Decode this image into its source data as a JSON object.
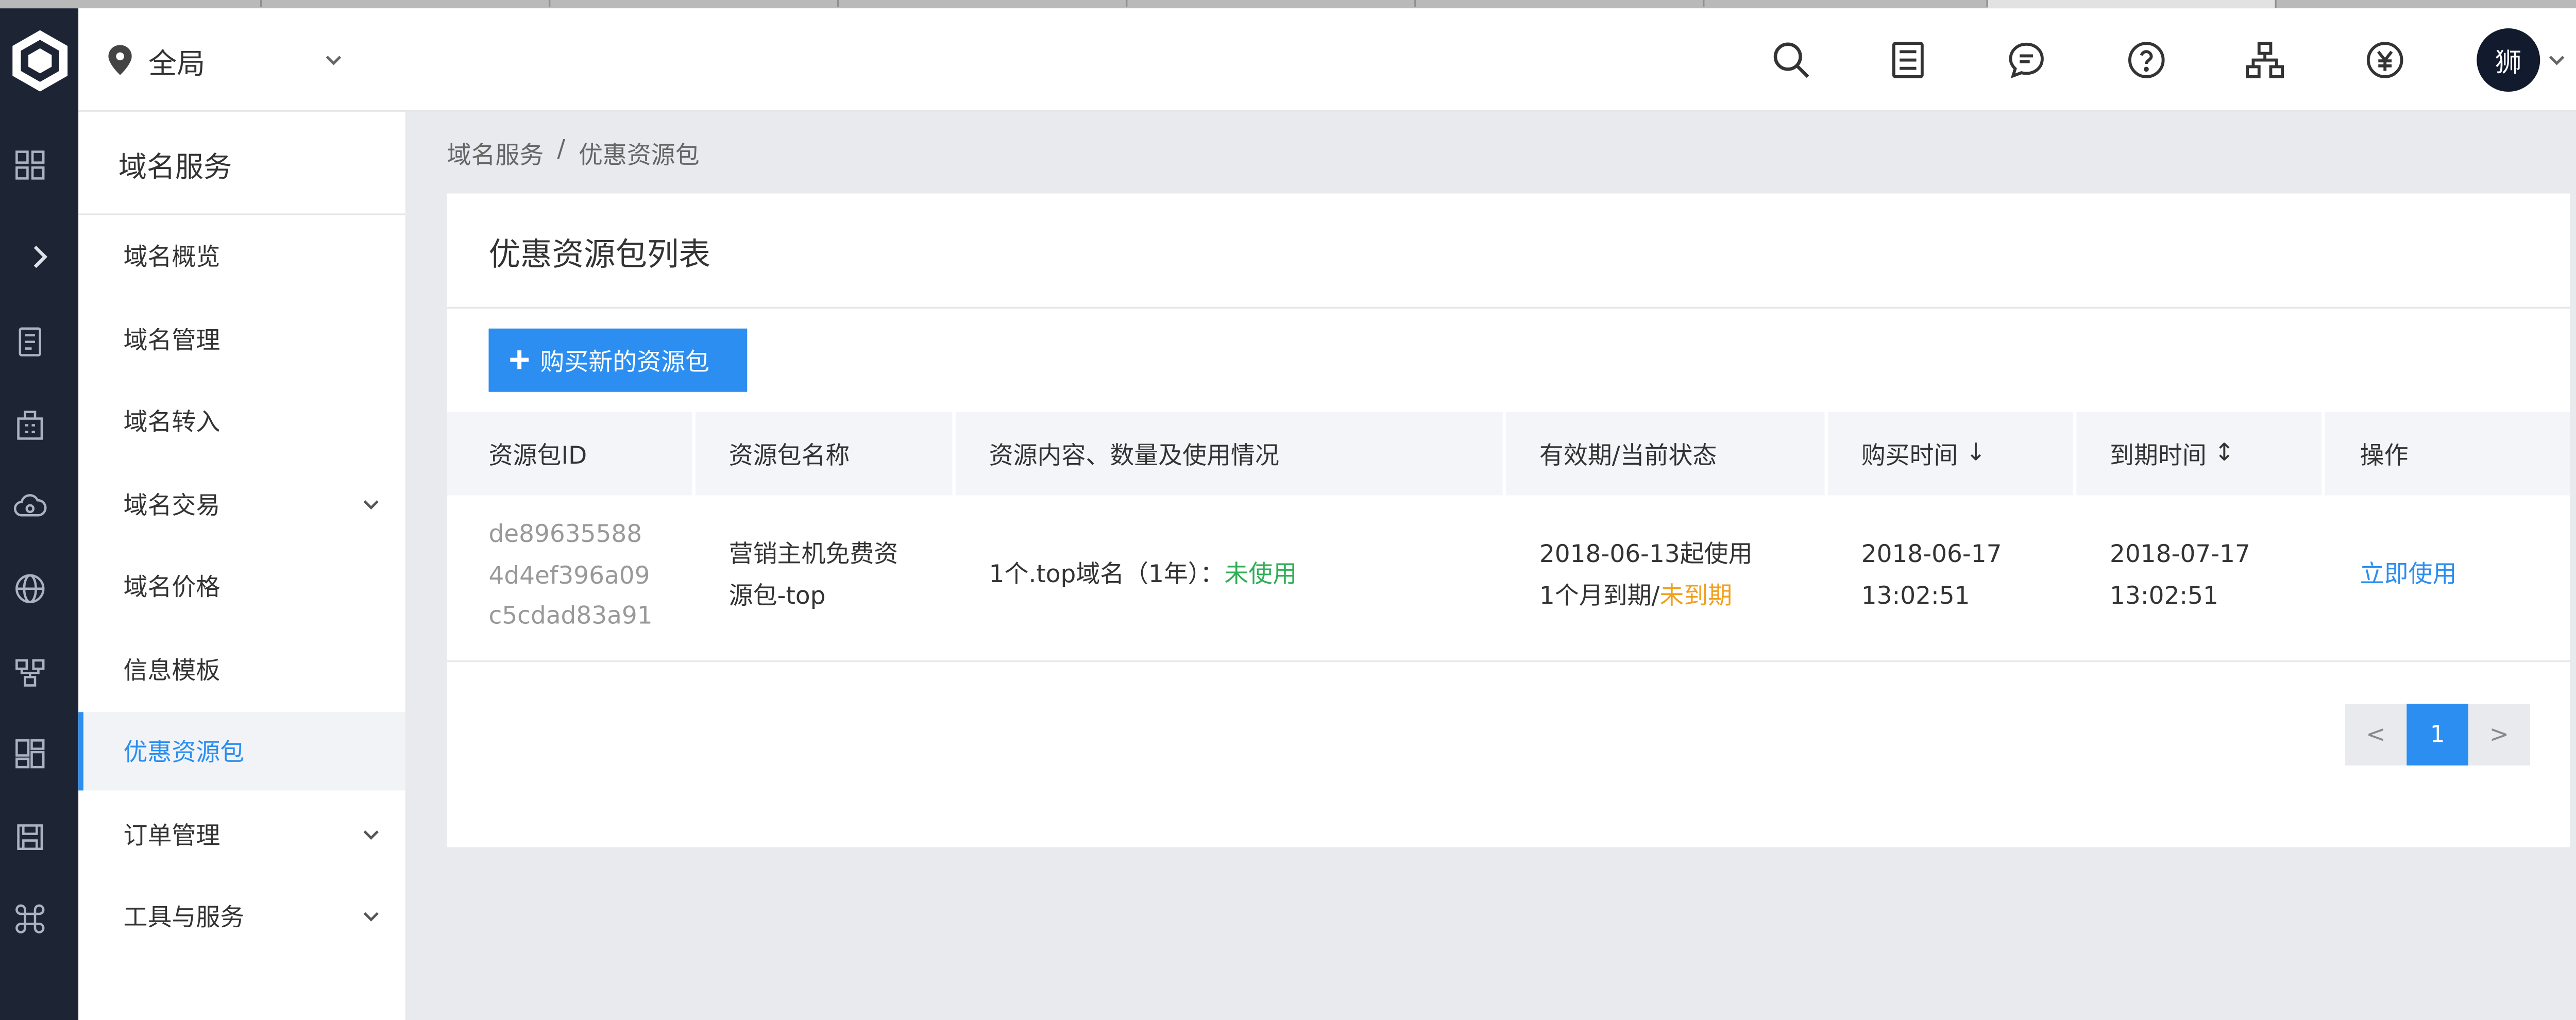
{
  "header": {
    "region_label": "全局",
    "avatar_text": "狮"
  },
  "icons": {
    "header": [
      "search-icon",
      "list-icon",
      "message-icon",
      "help-icon",
      "sitemap-icon",
      "billing-icon"
    ],
    "rail": [
      "logo-icon",
      "grid-icon",
      "expand-icon",
      "document-icon",
      "building-icon",
      "cloud-icon",
      "globe-icon",
      "network-icon",
      "dashboard-icon",
      "save-icon",
      "command-icon"
    ]
  },
  "sidebar": {
    "title": "域名服务",
    "items": [
      {
        "label": "域名概览",
        "expandable": false,
        "active": false
      },
      {
        "label": "域名管理",
        "expandable": false,
        "active": false
      },
      {
        "label": "域名转入",
        "expandable": false,
        "active": false
      },
      {
        "label": "域名交易",
        "expandable": true,
        "active": false
      },
      {
        "label": "域名价格",
        "expandable": false,
        "active": false
      },
      {
        "label": "信息模板",
        "expandable": false,
        "active": false
      },
      {
        "label": "优惠资源包",
        "expandable": false,
        "active": true
      },
      {
        "label": "订单管理",
        "expandable": true,
        "active": false
      },
      {
        "label": "工具与服务",
        "expandable": true,
        "active": false
      }
    ]
  },
  "breadcrumb": {
    "parent": "域名服务",
    "separator": "/",
    "current": "优惠资源包"
  },
  "card": {
    "title": "优惠资源包列表",
    "buy_button_label": "购买新的资源包"
  },
  "table": {
    "columns": [
      {
        "label": "资源包ID",
        "sort": ""
      },
      {
        "label": "资源包名称",
        "sort": ""
      },
      {
        "label": "资源内容、数量及使用情况",
        "sort": ""
      },
      {
        "label": "有效期/当前状态",
        "sort": ""
      },
      {
        "label": "购买时间",
        "sort": "↓"
      },
      {
        "label": "到期时间",
        "sort": "↕"
      },
      {
        "label": "操作",
        "sort": ""
      }
    ],
    "rows": [
      {
        "id_lines": [
          "de89635588",
          "4d4ef396a09",
          "c5cdad83a91"
        ],
        "name_lines": [
          "营销主机免费资",
          "源包-top"
        ],
        "content_prefix": "1个.top域名（1年）：",
        "content_status": "未使用",
        "validity_line1": "2018-06-13起使用",
        "validity_prefix": "1个月到期/",
        "validity_status": "未到期",
        "purchase_date": "2018-06-17",
        "purchase_time": "13:02:51",
        "expire_date": "2018-07-17",
        "expire_time": "13:02:51",
        "action": "立即使用"
      }
    ]
  },
  "pagination": {
    "prev": "<",
    "current": "1",
    "next": ">"
  },
  "colors": {
    "accent": "#2b8ef0",
    "rail_bg": "#1d2534",
    "status_unused": "#2fae55",
    "status_not_expired": "#f0a020"
  }
}
